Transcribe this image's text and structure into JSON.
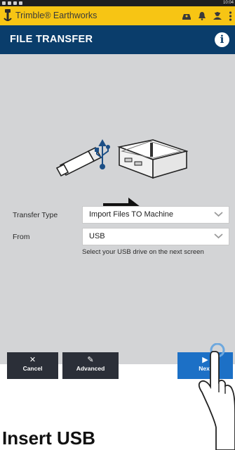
{
  "status_bar": {
    "time": "10:04"
  },
  "app_bar": {
    "brand": "Trimble® Earthworks"
  },
  "title_bar": {
    "title": "FILE TRANSFER",
    "info_icon": "i"
  },
  "form": {
    "transfer_type_label": "Transfer Type",
    "transfer_type_value": "Import Files TO Machine",
    "from_label": "From",
    "from_value": "USB",
    "hint": "Select your USB drive on the next screen"
  },
  "footer": {
    "cancel_label": "Cancel",
    "advanced_label": "Advanced",
    "next_label": "Next"
  },
  "overlay": {
    "caption": "Insert USB"
  },
  "colors": {
    "app_bar": "#f7c514",
    "title_bar": "#0a3d6b",
    "next": "#1c70c6",
    "dark_button": "#2b2f38"
  }
}
